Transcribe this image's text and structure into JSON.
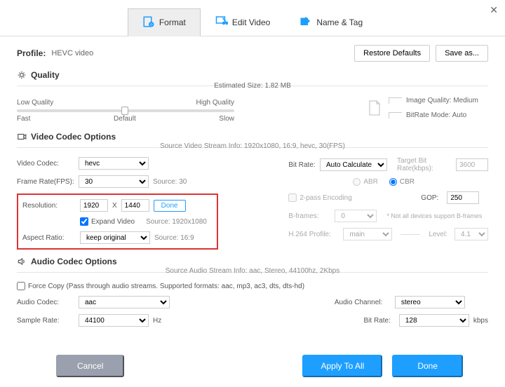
{
  "close": "✕",
  "tabs": {
    "format": "Format",
    "edit": "Edit Video",
    "name": "Name & Tag"
  },
  "profile": {
    "label": "Profile:",
    "value": "HEVC video"
  },
  "top_buttons": {
    "restore": "Restore Defaults",
    "save": "Save as..."
  },
  "quality": {
    "title": "Quality",
    "est": "Estimated Size:  1.82 MB",
    "low": "Low Quality",
    "high": "High Quality",
    "fast": "Fast",
    "default": "Default",
    "slow": "Slow",
    "iq": "Image Quality: Medium",
    "brm": "BitRate Mode: Auto"
  },
  "vco": {
    "title": "Video Codec Options",
    "src": "Source Video Stream Info: 1920x1080, 16:9, hevc, 30(FPS)",
    "vc_label": "Video Codec:",
    "vc_value": "hevc",
    "fr_label": "Frame Rate(FPS):",
    "fr_value": "30",
    "fr_src": "Source: 30",
    "res_label": "Resolution:",
    "res_w": "1920",
    "res_x": "X",
    "res_h": "1440",
    "done": "Done",
    "expand": "Expand Video",
    "res_src": "Source: 1920x1080",
    "ar_label": "Aspect Ratio:",
    "ar_value": "keep original",
    "ar_src": "Source: 16:9",
    "br_label": "Bit Rate:",
    "br_value": "Auto Calculate",
    "tbr_label": "Target Bit Rate(kbps):",
    "tbr_value": "3600",
    "abr": "ABR",
    "cbr": "CBR",
    "tp": "2-pass Encoding",
    "gop_label": "GOP:",
    "gop_value": "250",
    "bf_label": "B-frames:",
    "bf_value": "0",
    "bf_note": "* Not all devices support B-frames",
    "hp_label": "H.264 Profile:",
    "hp_value": "main",
    "lvl_label": "Level:",
    "lvl_value": "4.1"
  },
  "aco": {
    "title": "Audio Codec Options",
    "src": "Source Audio Stream Info: aac, Stereo, 44100hz, 2Kbps",
    "fc": "Force Copy (Pass through audio streams. Supported formats: aac, mp3, ac3, dts, dts-hd)",
    "ac_label": "Audio Codec:",
    "ac_value": "aac",
    "sr_label": "Sample Rate:",
    "sr_value": "44100",
    "hz": "Hz",
    "ach_label": "Audio Channel:",
    "ach_value": "stereo",
    "br_label": "Bit Rate:",
    "br_value": "128",
    "kbps": "kbps"
  },
  "footer": {
    "cancel": "Cancel",
    "apply": "Apply To All",
    "done": "Done"
  }
}
